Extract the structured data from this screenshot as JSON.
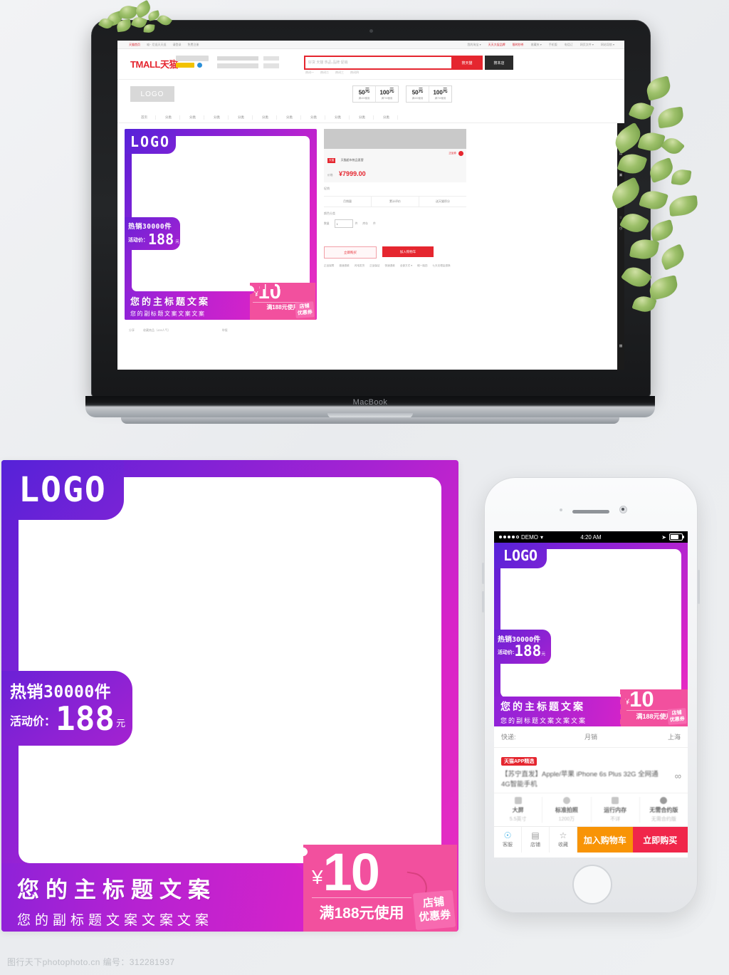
{
  "watermark": "图行天下photophoto.cn  编号：312281937",
  "laptop": {
    "brand_label": "MacBook",
    "page": {
      "topbar_left": [
        "天猫首页",
        "喵~ 尼逛天天逛",
        "请登录",
        "免费注册"
      ],
      "topbar_right": [
        "我的淘宝 ▾",
        "天天大促品牌",
        "限时秒杀",
        "收藏夹 ▾",
        "手机版",
        "电话订",
        "网页文件 ▾",
        "网站导航 ▾"
      ],
      "logo": "TMALL天猫",
      "search_placeholder": "好货 天猫 热品 品牌 促销",
      "search_button": "搜天猫",
      "search_shop_button": "搜本店",
      "hot_words": [
        "热词一",
        "热词二",
        "热词三",
        "热词四"
      ],
      "shop_logo": "LOGO",
      "coupons": [
        {
          "value": "50",
          "unit": "元",
          "rule": "满400使用"
        },
        {
          "value": "100",
          "unit": "元",
          "rule": "满700使用"
        },
        {
          "value": "50",
          "unit": "元",
          "rule": "满400使用"
        },
        {
          "value": "100",
          "unit": "元",
          "rule": "满700使用"
        }
      ],
      "nav_items": [
        "首页",
        "分类",
        "分类",
        "分类",
        "分类",
        "分类",
        "分类",
        "分类",
        "分类",
        "分类",
        "分类"
      ],
      "product": {
        "promo_tag": "天猫",
        "promo_label": "天猫超市热品直营",
        "badge": "正品券",
        "price_label": "价格",
        "price": "¥7999.00",
        "sub_label": "促销",
        "info_cells": [
          "月销量",
          "累计评价",
          "送天猫积分"
        ],
        "select_label": "颜色分类",
        "qty_label": "数量",
        "qty_value": "1",
        "qty_unit": "件",
        "stock_label": "库存",
        "stock_unit": "件",
        "buy_button": "立即购买",
        "cart_button": "加入购物车",
        "services_line1": [
          "正品保障",
          "极速退款",
          "闪电发货",
          "正品保证",
          "快速退款"
        ],
        "services_line2": [
          "假一赔四",
          "七天无理由退换"
        ],
        "services_more": "全部方式 ▾"
      },
      "share_row": [
        "分享",
        "收藏商品（439人气）",
        "举报"
      ],
      "rail_icons": [
        "cart-icon",
        "heart-icon",
        "shop-icon",
        "coupon-icon",
        "yen-icon",
        "favorite-icon",
        "star-icon",
        "history-icon",
        "grid-icon"
      ]
    }
  },
  "banner": {
    "logo": "LOGO",
    "hot_sale": "热销30000件",
    "price_label": "活动价：",
    "price_value": "188",
    "price_unit": "元",
    "main_title": "您的主标题文案",
    "sub_title": "您的副标题文案文案文案",
    "coupon": {
      "currency": "¥",
      "value": "10",
      "rule": "满188元使用",
      "tag_line1": "店铺",
      "tag_line2": "优惠券"
    },
    "colors": {
      "purple_start": "#5b1fd4",
      "magenta_end": "#ef31bf",
      "coupon_pink": "#f2509e",
      "tag_pink": "#f76ab0"
    }
  },
  "phone": {
    "status": {
      "carrier": "DEMO",
      "wifi_icon": "wifi-icon",
      "time": "4:20 AM",
      "location_icon": "location-arrow-icon",
      "battery_icon": "battery-icon"
    },
    "banner": {
      "logo": "LOGO",
      "hot_sale": "热销30000件",
      "price_label": "活动价:",
      "price_value": "188",
      "price_unit": "元",
      "main_title": "您的主标题文案",
      "sub_title": "您的副标题文案文案文案",
      "coupon": {
        "currency": "¥",
        "value": "10",
        "rule": "满188元使用",
        "tag_line1": "店铺",
        "tag_line2": "优惠券"
      }
    },
    "shipping_row": [
      "快递:",
      "月销",
      "上海"
    ],
    "app_badge": "天猫APP精选",
    "product_title": "【苏宁直发】Apple/苹果 iPhone 6s Plus 32G 全网通4G智能手机",
    "share_icon": "share-icon",
    "specs": [
      {
        "icon": "screen-icon",
        "name": "大屏",
        "value": "5.5英寸"
      },
      {
        "icon": "camera-icon",
        "name": "标准拍照",
        "value": "1200万"
      },
      {
        "icon": "memory-icon",
        "name": "运行内存",
        "value": "不详"
      },
      {
        "icon": "contract-icon",
        "name": "无需合约版",
        "value": "无需合约版"
      }
    ],
    "actions": [
      {
        "icon": "service-icon",
        "label": "客服"
      },
      {
        "icon": "shop-icon",
        "label": "店铺"
      },
      {
        "icon": "star-icon",
        "label": "收藏"
      }
    ],
    "cta": {
      "cart": "加入购物车",
      "buy": "立即购买"
    }
  }
}
